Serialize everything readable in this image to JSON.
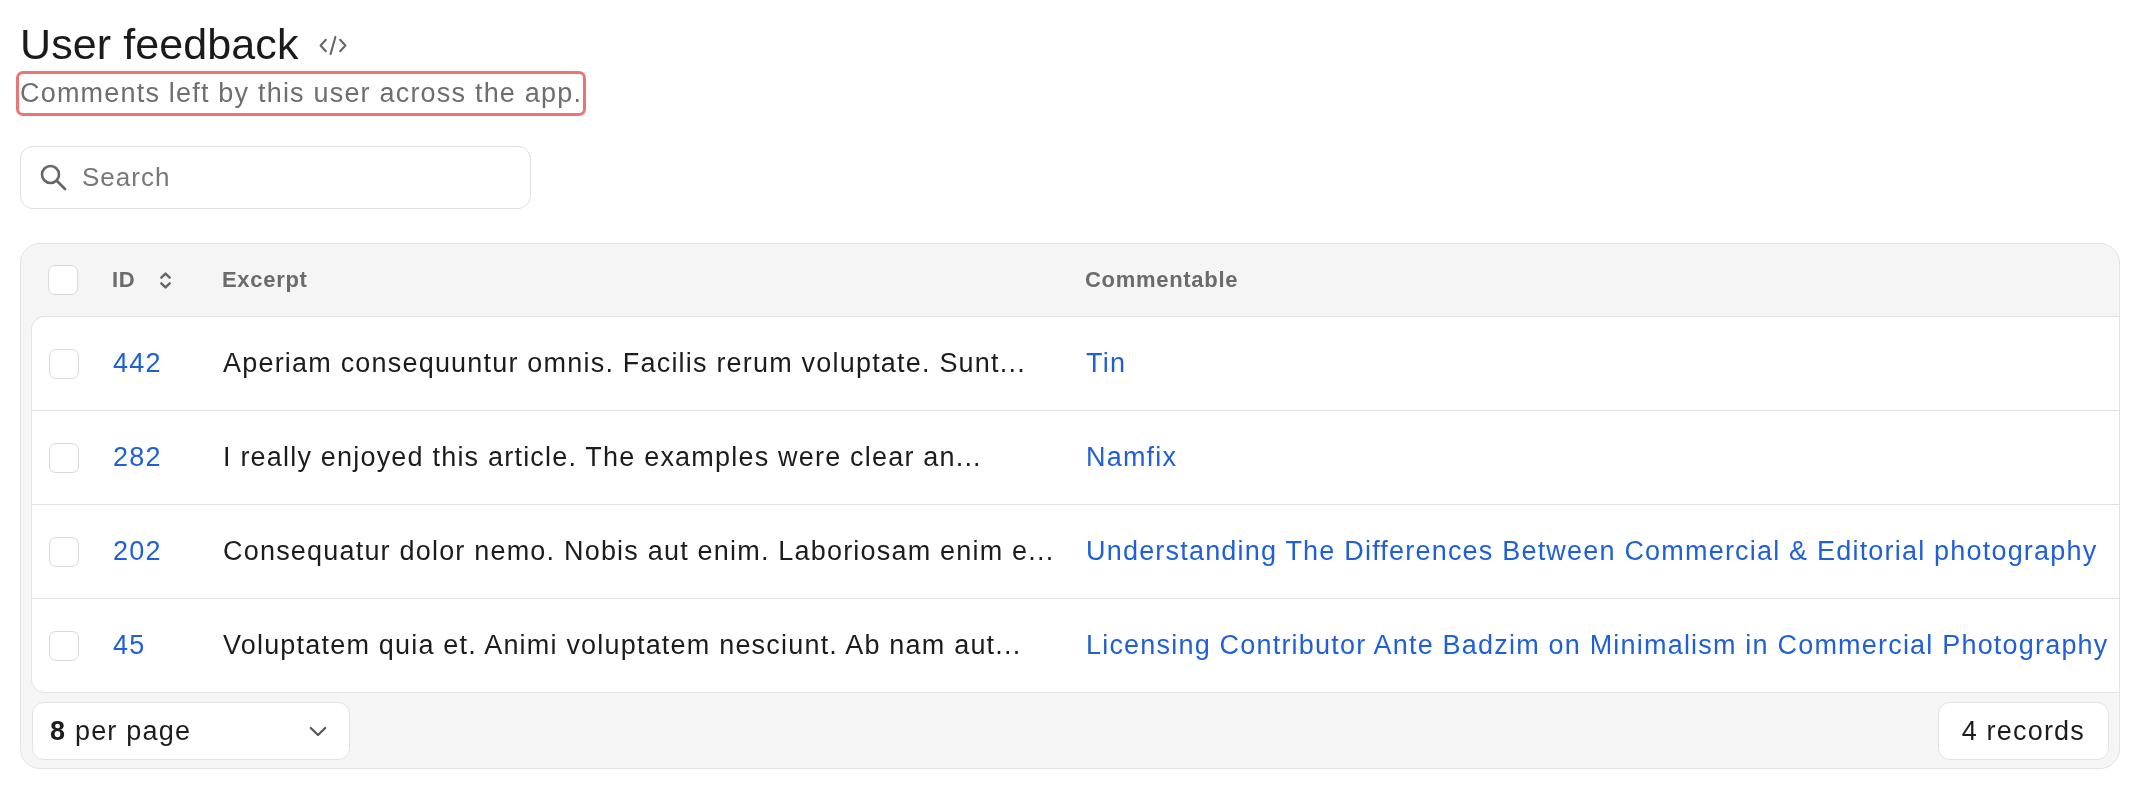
{
  "header": {
    "title": "User feedback",
    "subtitle": {
      "text": "Comments left by this user across the app.",
      "highlighted": true
    }
  },
  "search": {
    "placeholder": "Search"
  },
  "table": {
    "select_all": {
      "checked": false
    },
    "columns": [
      {
        "label": "ID",
        "sortable": true
      },
      {
        "label": "Excerpt",
        "sortable": false
      },
      {
        "label": "Commentable",
        "sortable": false
      }
    ],
    "rows": [
      {
        "checked": false,
        "id": "442",
        "excerpt": "Aperiam consequuntur omnis. Facilis rerum voluptate. Sunt...",
        "commentable": "Tin"
      },
      {
        "checked": false,
        "id": "282",
        "excerpt": "I really enjoyed this article. The examples were clear an...",
        "commentable": "Namfix"
      },
      {
        "checked": false,
        "id": "202",
        "excerpt": "Consequatur dolor nemo. Nobis aut enim. Laboriosam enim e...",
        "commentable": "Understanding The Differences Between Commercial & Editorial photography"
      },
      {
        "checked": false,
        "id": "45",
        "excerpt": "Voluptatem quia et. Animi voluptatem nesciunt. Ab nam aut...",
        "commentable": "Licensing Contributor Ante Badzim on Minimalism in Commercial Photography"
      }
    ]
  },
  "footer": {
    "per_page": "**8** per page",
    "records": "4 records"
  }
}
